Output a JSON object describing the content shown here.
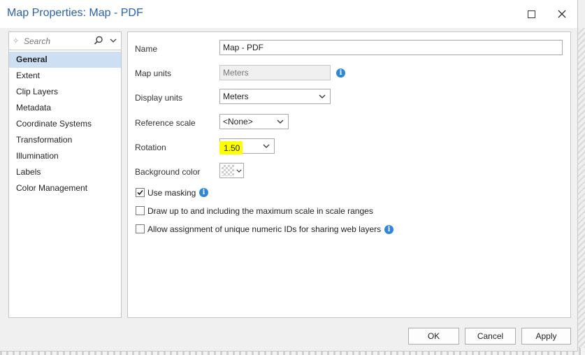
{
  "window": {
    "title": "Map Properties: Map - PDF"
  },
  "nav": {
    "search_placeholder": "Search",
    "items": [
      {
        "label": "General",
        "selected": true
      },
      {
        "label": "Extent"
      },
      {
        "label": "Clip Layers"
      },
      {
        "label": "Metadata"
      },
      {
        "label": "Coordinate Systems"
      },
      {
        "label": "Transformation"
      },
      {
        "label": "Illumination"
      },
      {
        "label": "Labels"
      },
      {
        "label": "Color Management"
      }
    ]
  },
  "general": {
    "name_label": "Name",
    "name_value": "Map - PDF",
    "map_units_label": "Map units",
    "map_units_value": "Meters",
    "display_units_label": "Display units",
    "display_units_value": "Meters",
    "reference_scale_label": "Reference scale",
    "reference_scale_value": "<None>",
    "rotation_label": "Rotation",
    "rotation_value": "1.50",
    "background_color_label": "Background color",
    "use_masking_label": "Use masking",
    "use_masking_checked": true,
    "draw_up_to_label": "Draw up to and including the maximum scale in scale ranges",
    "draw_up_to_checked": false,
    "allow_ids_label": "Allow assignment of unique numeric IDs for sharing web layers",
    "allow_ids_checked": false
  },
  "footer": {
    "ok_label": "OK",
    "cancel_label": "Cancel",
    "apply_label": "Apply"
  },
  "colors": {
    "title": "#2a63a9",
    "selection": "#cde0f3",
    "info": "#2f87d9",
    "highlight": "#ffff00"
  }
}
